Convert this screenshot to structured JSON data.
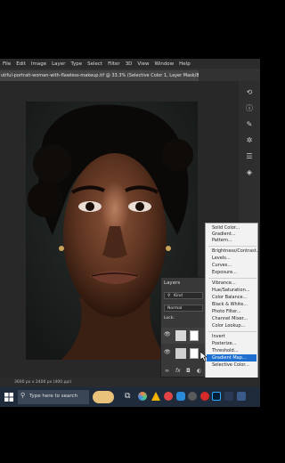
{
  "menu": {
    "items": [
      "File",
      "Edit",
      "Image",
      "Layer",
      "Type",
      "Select",
      "Filter",
      "3D",
      "View",
      "Window",
      "Help"
    ]
  },
  "document": {
    "tab_title": "utiful-portrait-woman-with-flawless-makeup.tif @ 33.3% (Selective Color 1, Layer Mask/8) *",
    "status": "3600 px x 2400 px (400 ppi)"
  },
  "layers_panel": {
    "title": "Layers",
    "kind_label": "Kind",
    "blend_mode": "Normal",
    "lock_label": "Lock:"
  },
  "adjustment_menu": {
    "items": [
      {
        "label": "Solid Color...",
        "group": 1
      },
      {
        "label": "Gradient...",
        "group": 1
      },
      {
        "label": "Pattern...",
        "group": 1
      },
      {
        "label": "Brightness/Contrast...",
        "group": 2
      },
      {
        "label": "Levels...",
        "group": 2
      },
      {
        "label": "Curves...",
        "group": 2
      },
      {
        "label": "Exposure...",
        "group": 2
      },
      {
        "label": "Vibrance...",
        "group": 3
      },
      {
        "label": "Hue/Saturation...",
        "group": 3
      },
      {
        "label": "Color Balance...",
        "group": 3
      },
      {
        "label": "Black & White...",
        "group": 3
      },
      {
        "label": "Photo Filter...",
        "group": 3
      },
      {
        "label": "Channel Mixer...",
        "group": 3
      },
      {
        "label": "Color Lookup...",
        "group": 3
      },
      {
        "label": "Invert",
        "group": 4
      },
      {
        "label": "Posterize...",
        "group": 4
      },
      {
        "label": "Threshold...",
        "group": 4
      },
      {
        "label": "Gradient Map...",
        "group": 4,
        "highlighted": true
      },
      {
        "label": "Selective Color...",
        "group": 4
      }
    ]
  },
  "taskbar": {
    "search_placeholder": "Type here to search"
  },
  "colors": {
    "highlight": "#1e6fd0",
    "taskbar": "#1f2a3a",
    "panel": "#383838"
  }
}
